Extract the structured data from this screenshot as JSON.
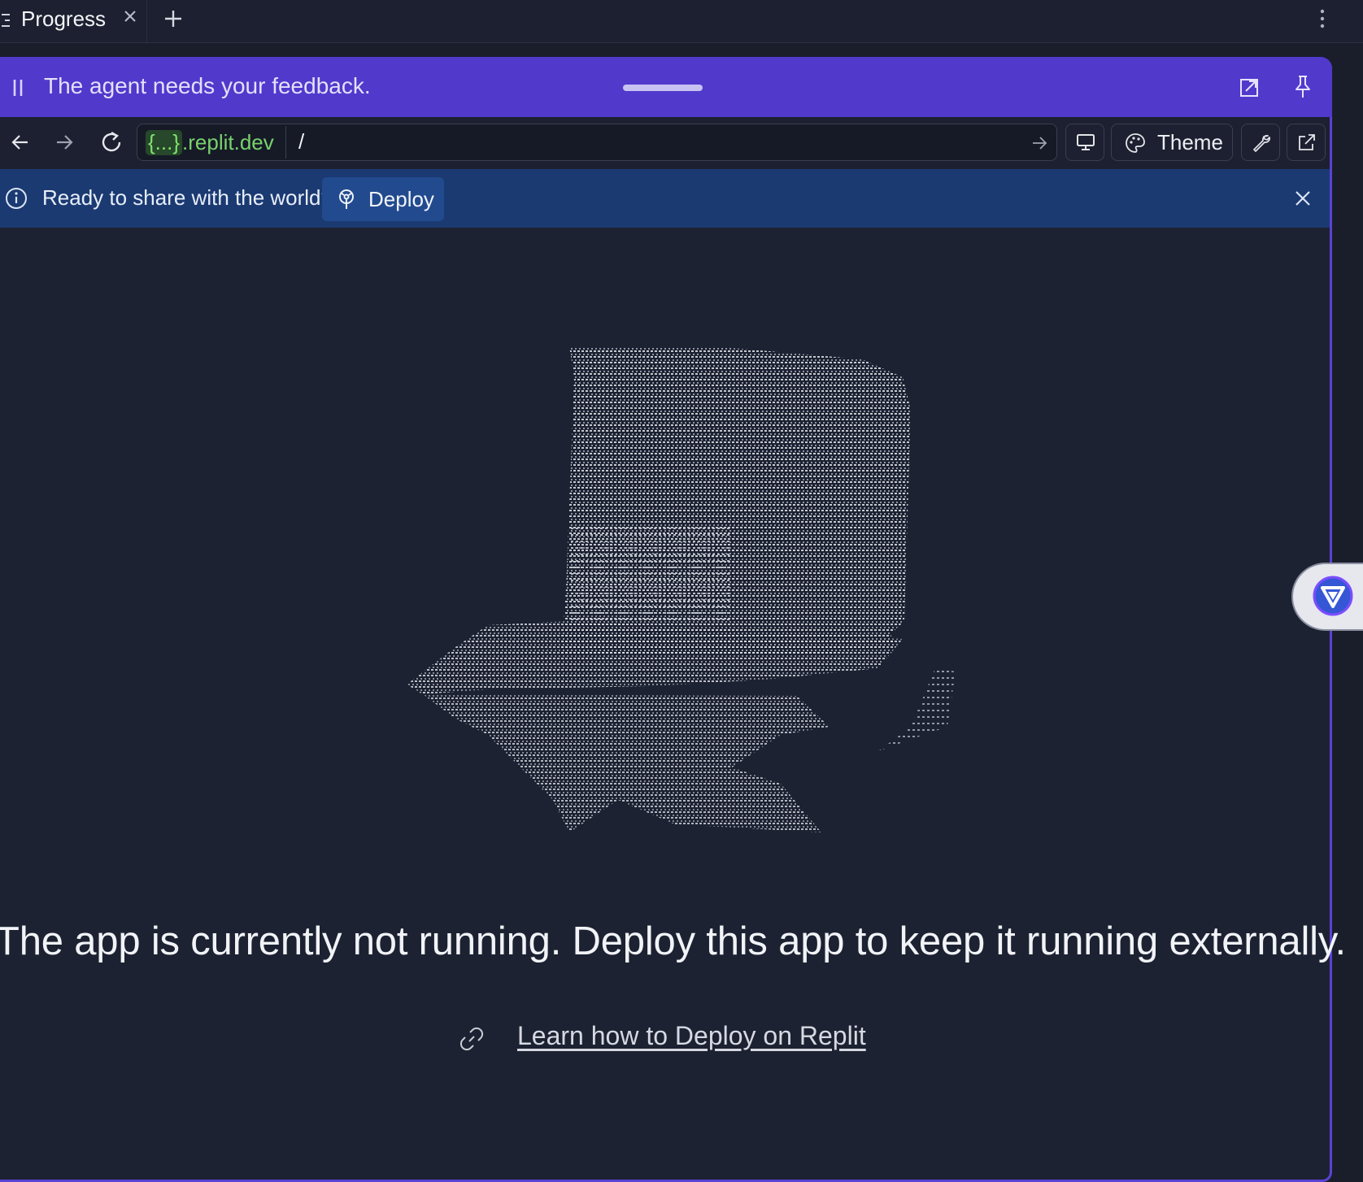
{
  "tab": {
    "title": "Progress"
  },
  "agent_bar": {
    "message": "The agent needs your feedback."
  },
  "url_bar": {
    "domain_braces": "{...}",
    "domain_rest": ".replit.dev",
    "path": "/"
  },
  "toolbar": {
    "theme_label": "Theme"
  },
  "banner": {
    "message": "Ready to share with the world?",
    "deploy_label": "Deploy"
  },
  "content": {
    "headline": "The app is currently not running. Deploy this app to keep it running externally.",
    "learn_link": "Learn how to Deploy on Replit"
  },
  "colors": {
    "accent_purple": "#5139cc",
    "banner_blue": "#1b3a72",
    "url_green": "#78d26c",
    "background": "#1d2232"
  },
  "icons": {
    "tab": "list-icon",
    "close": "close-icon",
    "add": "plus-icon",
    "menu": "kebab-icon",
    "pause": "pause-icon",
    "expand": "expand-icon",
    "pin": "pin-icon",
    "back": "arrow-left-icon",
    "forward": "arrow-right-icon",
    "reload": "reload-icon",
    "go": "arrow-right-icon",
    "device": "monitor-icon",
    "theme": "palette-icon",
    "devtools": "wrench-icon",
    "newtab": "external-link-icon",
    "info": "info-icon",
    "deploy": "deploy-icon",
    "link": "link-icon",
    "floater": "v-logo-icon"
  }
}
